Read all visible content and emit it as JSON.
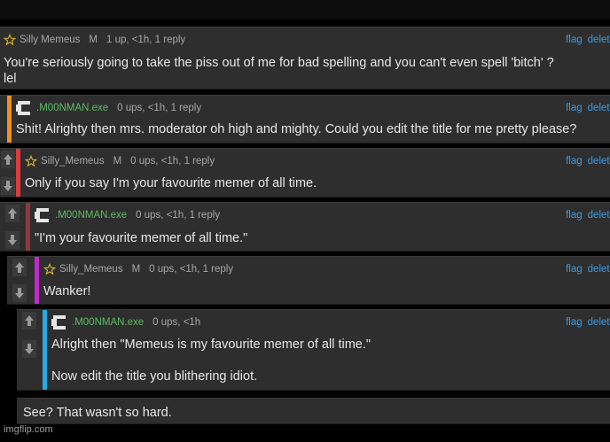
{
  "comments": [
    {
      "user": "Silly  Memeus",
      "mod": "M",
      "meta": "1 up, <1h, 1 reply",
      "flag": "flag",
      "delete": "delete",
      "line1": "You're seriously going to take the piss out of me for bad spelling and you can't even spell 'bitch' ?",
      "line2": "lel"
    },
    {
      "user": ".M00NMAN.exe",
      "meta": "0 ups, <1h, 1 reply",
      "flag": "flag",
      "delete": "delete",
      "line1": "Shit! Alrighty then mrs. moderator oh high and mighty. Could you edit the title for me pretty please?",
      "bar_color": "#f0901e"
    },
    {
      "user": "Silly_Memeus",
      "mod": "M",
      "meta": "0 ups, <1h, 1 reply",
      "flag": "flag",
      "delete": "delete",
      "line1": "Only if you say I'm your favourite memer of all time.",
      "bar_color": "#e03a3a"
    },
    {
      "user": ".M00NMAN.exe",
      "meta": "0 ups, <1h, 1 reply",
      "flag": "flag",
      "delete": "delete",
      "line1": "\"I'm your favourite memer of all time.\"",
      "bar_color": "#8a3a3a"
    },
    {
      "user": "Silly_Memeus",
      "mod": "M",
      "meta": "0 ups, <1h, 1 reply",
      "flag": "flag",
      "delete": "delete",
      "line1": "Wanker!",
      "bar_color": "#c02ac8"
    },
    {
      "user": ".M00NMAN.exe",
      "meta": "0 ups, <1h",
      "flag": "flag",
      "delete": "delete",
      "line1": "Alright then \"Memeus is my favourite memer of all time.\"",
      "line2": "Now edit the title you blithering idiot.",
      "bar_color": "#27a9e1"
    },
    {
      "line1": "See? That wasn't so hard."
    }
  ],
  "watermark": "imgflip.com",
  "icons": {
    "star": "star-icon",
    "avatar": "pixel-avatar-icon",
    "up": "arrow-up-icon",
    "down": "arrow-down-icon"
  }
}
